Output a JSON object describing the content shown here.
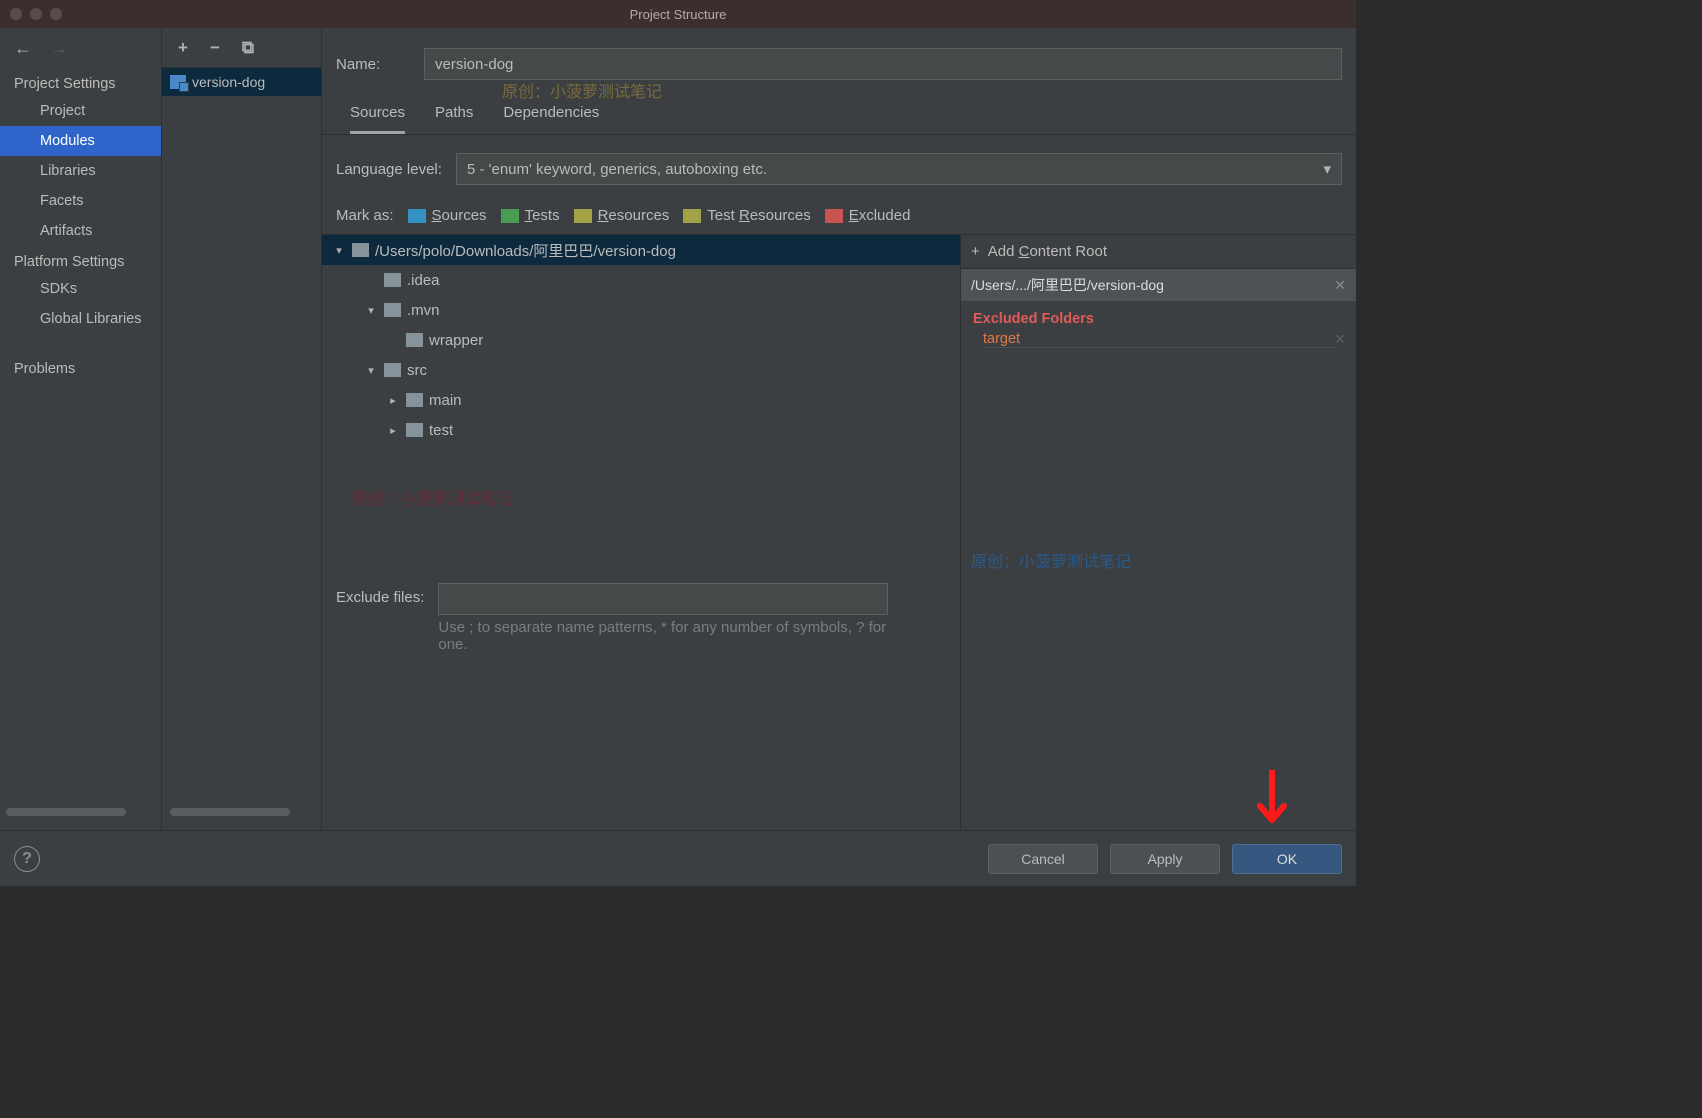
{
  "window": {
    "title": "Project Structure"
  },
  "sidebar": {
    "back_enabled": true,
    "sections": [
      {
        "title": "Project Settings",
        "items": [
          "Project",
          "Modules",
          "Libraries",
          "Facets",
          "Artifacts"
        ],
        "selected": 1
      },
      {
        "title": "Platform Settings",
        "items": [
          "SDKs",
          "Global Libraries"
        ]
      },
      {
        "title": "",
        "items": [
          "Problems"
        ]
      }
    ]
  },
  "modules": {
    "items": [
      "version-dog"
    ]
  },
  "main": {
    "name_label": "Name:",
    "name_value": "version-dog",
    "tabs": [
      "Sources",
      "Paths",
      "Dependencies"
    ],
    "active_tab": 0,
    "watermark_center": "原创：小菠萝测试笔记",
    "language_level_label": "Language level:",
    "language_level_value": "5 - 'enum' keyword, generics, autoboxing etc.",
    "mark_as_label": "Mark as:",
    "marks": [
      {
        "label": "Sources",
        "letter": "S",
        "color": "blue"
      },
      {
        "label": "Tests",
        "letter": "T",
        "color": "green"
      },
      {
        "label": "Resources",
        "letter": "R",
        "color": "beige"
      },
      {
        "label": "Test Resources",
        "letter": "R",
        "color": "beige2"
      },
      {
        "label": "Excluded",
        "letter": "E",
        "color": "orange"
      }
    ],
    "tree": [
      {
        "depth": 0,
        "expanded": true,
        "label": "/Users/polo/Downloads/阿里巴巴/version-dog",
        "root": true
      },
      {
        "depth": 1,
        "expanded": null,
        "label": ".idea"
      },
      {
        "depth": 1,
        "expanded": true,
        "label": ".mvn"
      },
      {
        "depth": 2,
        "expanded": null,
        "label": "wrapper"
      },
      {
        "depth": 1,
        "expanded": true,
        "label": "src"
      },
      {
        "depth": 2,
        "expanded": false,
        "label": "main"
      },
      {
        "depth": 2,
        "expanded": false,
        "label": "test"
      }
    ],
    "watermark_left": "原创：小菠萝测试笔记",
    "content_root": {
      "add_label": "Add Content Root",
      "path": "/Users/.../阿里巴巴/version-dog",
      "excluded_header": "Excluded Folders",
      "excluded_items": [
        "target"
      ]
    },
    "watermark_right": "原创：小菠萝测试笔记",
    "exclude_files_label": "Exclude files:",
    "exclude_hint": "Use ; to separate name patterns, * for any number of symbols, ? for one."
  },
  "footer": {
    "cancel": "Cancel",
    "apply": "Apply",
    "ok": "OK"
  }
}
